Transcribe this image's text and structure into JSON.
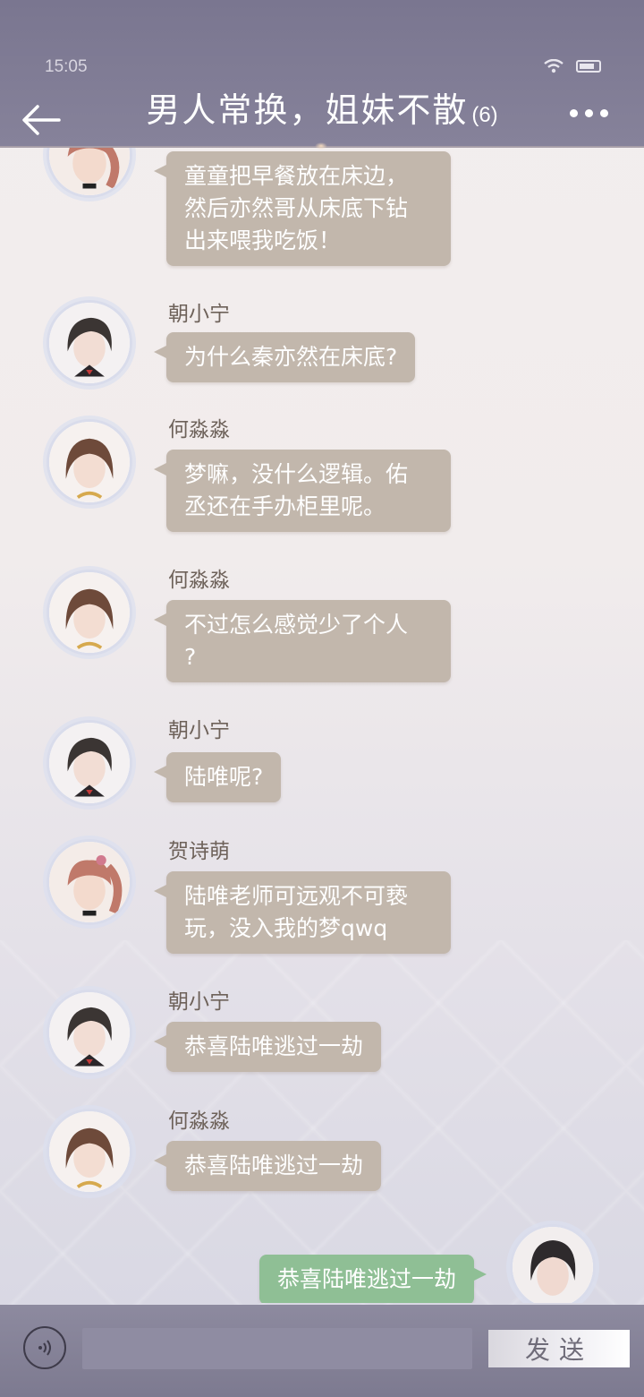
{
  "status_bar": {
    "time": "15:05"
  },
  "header": {
    "title": "男人常换，姐妹不散",
    "member_count": "(6)"
  },
  "messages": [
    {
      "sender": "",
      "avatar": "girl-ponytail-avatar",
      "lines": [
        "童童把早餐放在床边，",
        "然后亦然哥从床底下钻",
        "出来喂我吃饭！"
      ]
    },
    {
      "sender": "朝小宁",
      "avatar": "short-dark-hair-avatar",
      "lines": [
        "为什么秦亦然在床底?"
      ]
    },
    {
      "sender": "何淼淼",
      "avatar": "brown-bob-avatar",
      "lines": [
        "梦嘛，没什么逻辑。佑",
        "丞还在手办柜里呢。"
      ]
    },
    {
      "sender": "何淼淼",
      "avatar": "brown-bob-avatar",
      "lines": [
        "不过怎么感觉少了个人",
        "?"
      ]
    },
    {
      "sender": "朝小宁",
      "avatar": "short-dark-hair-avatar",
      "lines": [
        "陆唯呢?"
      ]
    },
    {
      "sender": "贺诗萌",
      "avatar": "girl-ponytail-avatar",
      "lines": [
        "陆唯老师可远观不可亵",
        "玩，没入我的梦qwq"
      ]
    },
    {
      "sender": "朝小宁",
      "avatar": "short-dark-hair-avatar",
      "lines": [
        "恭喜陆唯逃过一劫"
      ]
    },
    {
      "sender": "何淼淼",
      "avatar": "brown-bob-avatar",
      "lines": [
        "恭喜陆唯逃过一劫"
      ]
    }
  ],
  "my_message": {
    "avatar": "self-avatar",
    "text": "恭喜陆唯逃过一劫"
  },
  "input": {
    "placeholder": "",
    "value": "",
    "send_label": "发送"
  },
  "colors": {
    "header_bg": "#7a7690",
    "bubble_other": "#c2b7ac",
    "bubble_mine": "#8fbf95",
    "sender_text": "#6e625a"
  }
}
